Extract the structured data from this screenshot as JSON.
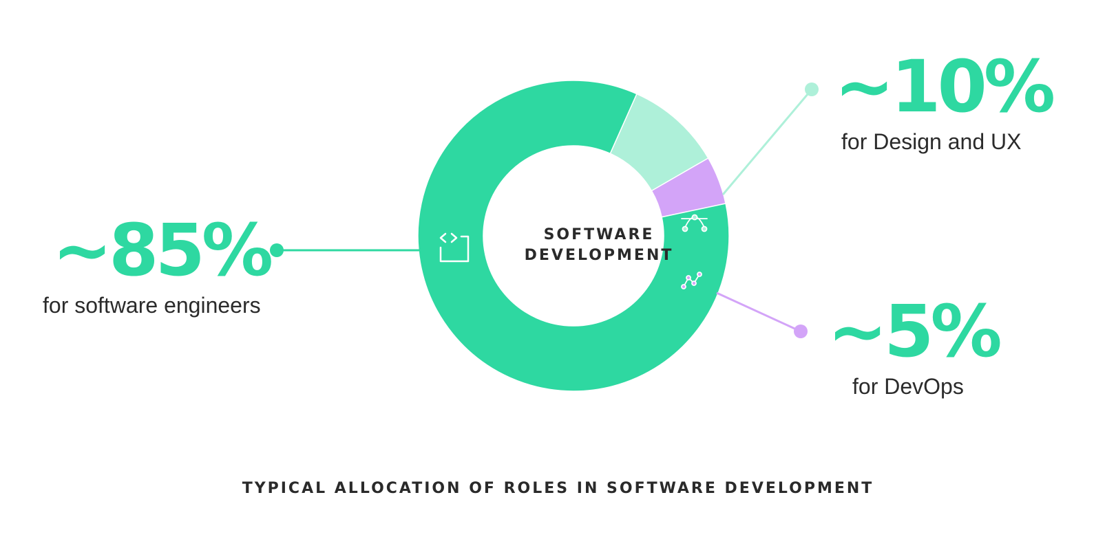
{
  "chart_data": {
    "type": "pie",
    "title": "TYPICAL ALLOCATION OF ROLES IN SOFTWARE DEVELOPMENT",
    "center_label": [
      "SOFTWARE",
      "DEVELOPMENT"
    ],
    "slices": [
      {
        "value": 85,
        "display": "~85%",
        "label": "for software engineers",
        "color": "#2ed8a1",
        "icon": "code-bracket-icon"
      },
      {
        "value": 10,
        "display": "~10%",
        "label": "for Design and UX",
        "color": "#aef0d9",
        "icon": "bezier-pen-icon"
      },
      {
        "value": 5,
        "display": "~5%",
        "label": "for DevOps",
        "color": "#d3a4f8",
        "icon": "pipeline-graph-icon"
      }
    ]
  },
  "colors": {
    "accent": "#2ed8a1",
    "light_accent": "#aef0d9",
    "purple": "#d3a4f8",
    "text": "#2a2a2a"
  }
}
